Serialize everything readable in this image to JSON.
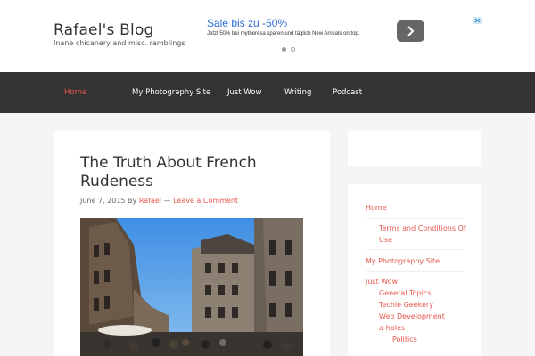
{
  "header": {
    "site_title": "Rafael's Blog",
    "site_description": "Inane chicanery and misc. ramblings"
  },
  "ad": {
    "headline": "Sale bis zu -50%",
    "body": "Jetzt 50% bei mytheresa sparen und täglich New Arrivals on top.",
    "next_icon": "chevron-right-icon",
    "adchoices_icon": "adchoices-icon",
    "accent": "#2a6bd6"
  },
  "nav": {
    "items": [
      {
        "label": "Home",
        "active": true
      },
      {
        "label": "My Photography Site"
      },
      {
        "label": "Just Wow"
      },
      {
        "label": "Writing"
      },
      {
        "label": "Podcast"
      }
    ]
  },
  "post": {
    "title": "The Truth About French Rudeness",
    "date": "June 7, 2015",
    "by": "By",
    "author": "Rafael",
    "separator": "—",
    "comment_link": "Leave a Comment"
  },
  "sidebar": {
    "items": [
      {
        "label": "Home",
        "level": 0
      },
      {
        "label": "Terms and Conditions Of Use",
        "level": 1
      },
      {
        "label": "My Photography Site",
        "level": 0
      },
      {
        "label": "Just Wow",
        "level": 0
      },
      {
        "label": "General Topics",
        "level": 1
      },
      {
        "label": "Techie Geekery",
        "level": 1
      },
      {
        "label": "Web Development",
        "level": 1
      },
      {
        "label": "a-holes",
        "level": 1
      },
      {
        "label": "Politics",
        "level": 2
      }
    ]
  },
  "colors": {
    "link": "#e5554e",
    "nav_bg": "#333333",
    "page_bg": "#f5f5f5"
  }
}
